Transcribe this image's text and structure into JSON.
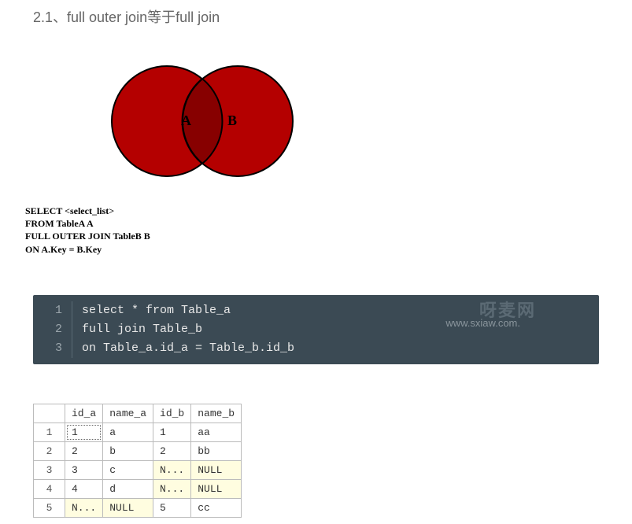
{
  "heading": "2.1、full outer join等于full join",
  "venn": {
    "labelA": "A",
    "labelB": "B",
    "sql": [
      "SELECT <select_list>",
      "FROM TableA A",
      "FULL OUTER JOIN TableB B",
      "ON A.Key = B.Key"
    ]
  },
  "watermark_main": "呀麦网",
  "watermark_sub": "www.sxiaw.com.",
  "code_lines": [
    "select * from Table_a",
    "full join Table_b",
    "on Table_a.id_a = Table_b.id_b"
  ],
  "table": {
    "headers": [
      "id_a",
      "name_a",
      "id_b",
      "name_b"
    ],
    "rows": [
      {
        "n": "1",
        "id_a": "1",
        "name_a": "a",
        "id_b": "1",
        "name_b": "aa",
        "null_a": false,
        "null_b": false,
        "dot": true
      },
      {
        "n": "2",
        "id_a": "2",
        "name_a": "b",
        "id_b": "2",
        "name_b": "bb",
        "null_a": false,
        "null_b": false,
        "dot": false
      },
      {
        "n": "3",
        "id_a": "3",
        "name_a": "c",
        "id_b": "N...",
        "name_b": "NULL",
        "null_a": false,
        "null_b": true,
        "dot": false
      },
      {
        "n": "4",
        "id_a": "4",
        "name_a": "d",
        "id_b": "N...",
        "name_b": "NULL",
        "null_a": false,
        "null_b": true,
        "dot": false
      },
      {
        "n": "5",
        "id_a": "N...",
        "name_a": "NULL",
        "id_b": "5",
        "name_b": "cc",
        "null_a": true,
        "null_b": false,
        "dot": false
      }
    ]
  }
}
